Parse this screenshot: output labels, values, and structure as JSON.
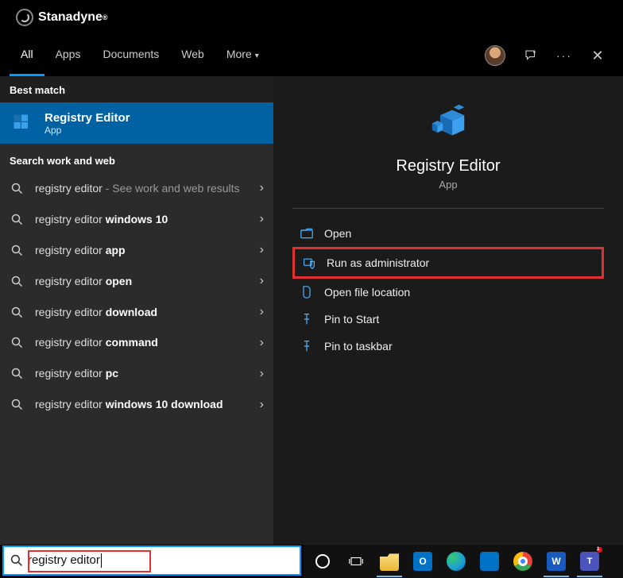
{
  "brand": "Stanadyne",
  "tabs": {
    "all": "All",
    "apps": "Apps",
    "documents": "Documents",
    "web": "Web",
    "more": "More"
  },
  "sections": {
    "best_match": "Best match",
    "search_web": "Search work and web"
  },
  "best_match": {
    "title": "Registry Editor",
    "subtitle": "App"
  },
  "results": [
    {
      "pre": "registry editor",
      "bold": "",
      "note": " - See work and web results"
    },
    {
      "pre": "registry editor ",
      "bold": "windows 10",
      "note": ""
    },
    {
      "pre": "registry editor ",
      "bold": "app",
      "note": ""
    },
    {
      "pre": "registry editor ",
      "bold": "open",
      "note": ""
    },
    {
      "pre": "registry editor ",
      "bold": "download",
      "note": ""
    },
    {
      "pre": "registry editor ",
      "bold": "command",
      "note": ""
    },
    {
      "pre": "registry editor ",
      "bold": "pc",
      "note": ""
    },
    {
      "pre": "registry editor ",
      "bold": "windows 10 download",
      "note": ""
    }
  ],
  "preview": {
    "title": "Registry Editor",
    "subtitle": "App"
  },
  "actions": {
    "open": "Open",
    "run_admin": "Run as administrator",
    "open_loc": "Open file location",
    "pin_start": "Pin to Start",
    "pin_taskbar": "Pin to taskbar"
  },
  "search_value": "registry editor"
}
